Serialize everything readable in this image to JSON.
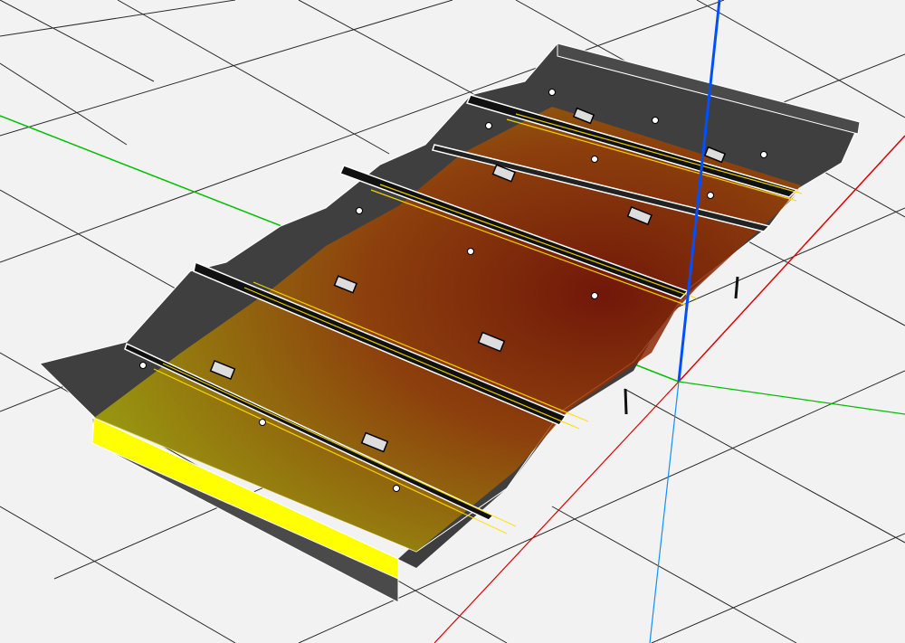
{
  "viewport": {
    "background": "#f2f2f2",
    "grid_color": "#2b2b2b",
    "axis_colors": {
      "x": "#e00000",
      "y": "#00c000",
      "z": "#0050ff"
    }
  },
  "model": {
    "body_color": "#4a4a4a",
    "edge_color": "#ffffff",
    "heatmap_colors": {
      "low": "#b5b000",
      "mid": "#a04000",
      "high": "#7a1000"
    },
    "face_highlight": "#ffff00",
    "ridge_count": 5,
    "sensor_box_count": 8,
    "anchor_dot_count": 12
  }
}
